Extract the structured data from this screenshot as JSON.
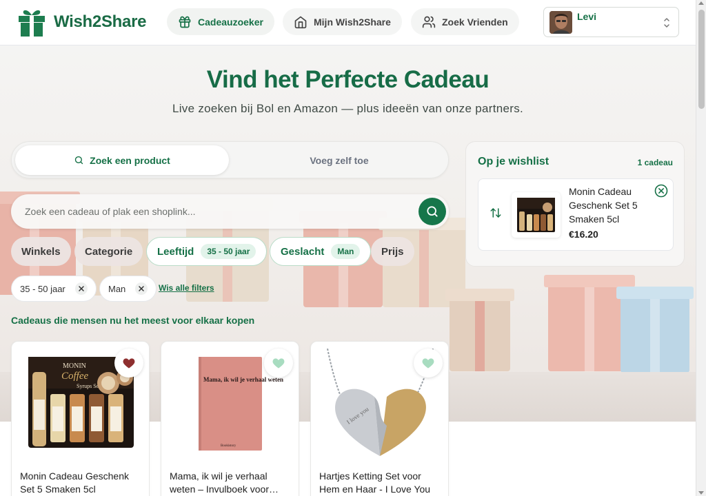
{
  "brand": {
    "name": "Wish2Share"
  },
  "nav": {
    "items": [
      {
        "label": "Cadeauzoeker",
        "icon": "gift-icon",
        "active": true
      },
      {
        "label": "Mijn Wish2Share",
        "icon": "home-icon",
        "active": false
      },
      {
        "label": "Zoek Vrienden",
        "icon": "users-icon",
        "active": false
      }
    ]
  },
  "user": {
    "name": "Levi"
  },
  "hero": {
    "title": "Vind het Perfecte Cadeau",
    "subtitle": "Live zoeken bij Bol en Amazon — plus ideeën van onze partners."
  },
  "tabs": {
    "search_label": "Zoek een product",
    "add_label": "Voeg zelf toe"
  },
  "search": {
    "placeholder": "Zoek een cadeau of plak een shoplink..."
  },
  "filters": {
    "winkels": "Winkels",
    "categorie": "Categorie",
    "leeftijd": {
      "label": "Leeftijd",
      "value": "35 - 50 jaar"
    },
    "geslacht": {
      "label": "Geslacht",
      "value": "Man"
    },
    "prijs": "Prijs"
  },
  "active_filters": {
    "age": "35 - 50 jaar",
    "gender": "Man",
    "clear_label": "Wis alle filters"
  },
  "section": {
    "popular_heading": "Cadeaus die mensen nu het meest voor elkaar kopen"
  },
  "products": [
    {
      "title": "Monin Cadeau Geschenk Set 5 Smaken 5cl",
      "favorited": true
    },
    {
      "title": "Mama, ik wil je verhaal weten – Invulboek voor moeder",
      "favorited": false,
      "book_text": "Mama, ik wil je verhaal weten",
      "publisher": "Bookistory"
    },
    {
      "title": "Hartjes Ketting Set voor Hem en Haar - I Love You",
      "favorited": false,
      "engraving": "I love you"
    }
  ],
  "wishlist": {
    "title": "Op je wishlist",
    "count": "1 cadeau",
    "items": [
      {
        "name": "Monin Cadeau Geschenk Set 5 Smaken 5cl",
        "price": "€16.20"
      }
    ]
  },
  "product_image_texts": {
    "monin": "MONIN",
    "coffee": "Coffee",
    "syrups": "Syrups Set"
  },
  "colors": {
    "brand_green": "#157046",
    "heart_red": "#8e2f2f",
    "heart_mint": "#a8dcc0"
  }
}
